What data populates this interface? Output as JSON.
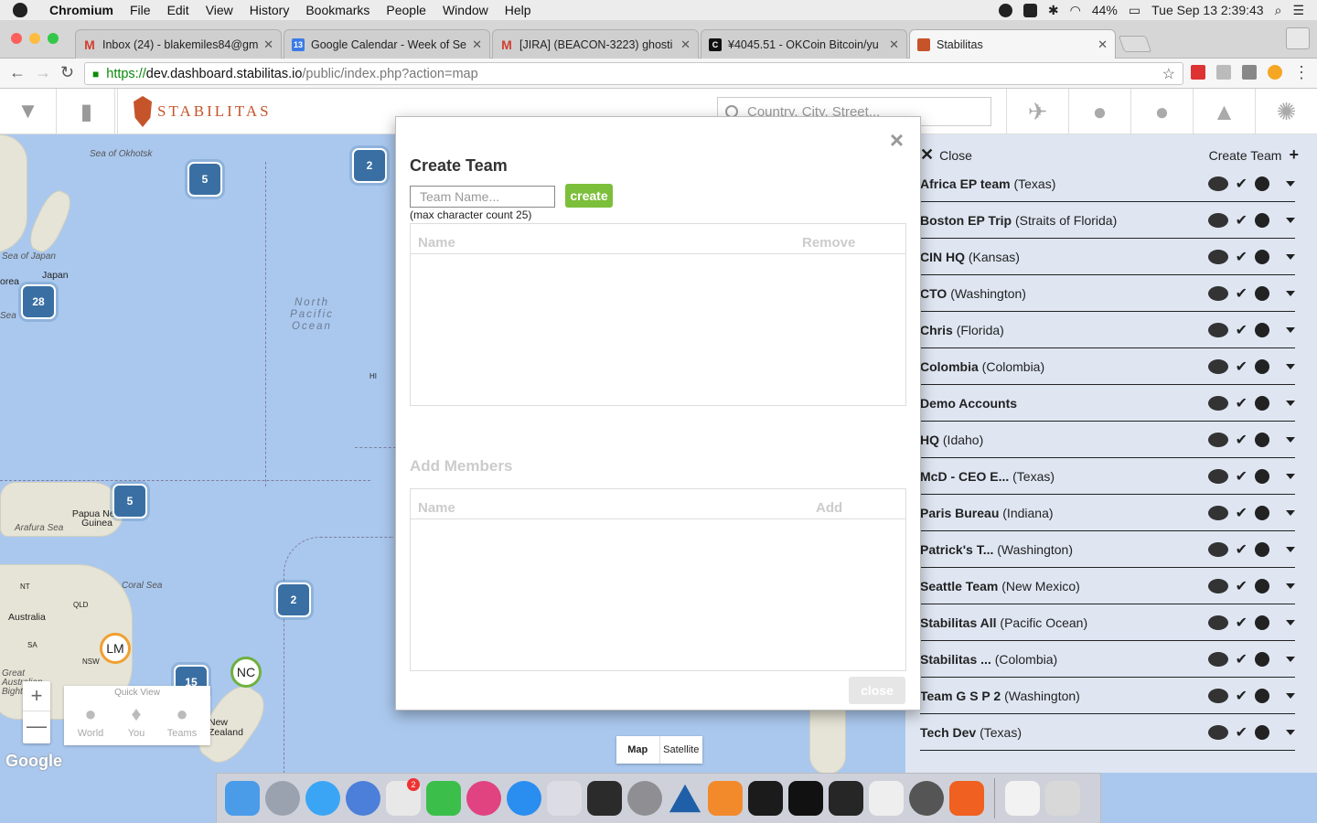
{
  "menubar": {
    "items": [
      "Chromium",
      "File",
      "Edit",
      "View",
      "History",
      "Bookmarks",
      "People",
      "Window",
      "Help"
    ],
    "battery": "44%",
    "clock": "Tue Sep 13  2:39:43"
  },
  "tabs": [
    {
      "title": "Inbox (24) - blakemiles84@gm",
      "favicon": "gmail-icon",
      "color": "#d23f31"
    },
    {
      "title": "Google Calendar - Week of Se",
      "favicon": "calendar-icon",
      "color": "#3b7be8",
      "fav_text": "13"
    },
    {
      "title": "[JIRA] (BEACON-3223) ghosti",
      "favicon": "gmail-icon",
      "color": "#d23f31"
    },
    {
      "title": "¥4045.51 - OKCoin Bitcoin/yu",
      "favicon": "okcoin-icon",
      "color": "#111",
      "fav_text": "C"
    },
    {
      "title": "Stabilitas",
      "favicon": "stabilitas-icon",
      "color": "#c6542a"
    }
  ],
  "address": {
    "scheme": "https://",
    "host": "dev.dashboard.stabilitas.io",
    "path": "/public/index.php?action=map"
  },
  "app": {
    "logo_text": "STABILITAS",
    "search_placeholder": "Country, City, Street..."
  },
  "map": {
    "labels": [
      {
        "text": "Sea of Okhotsk"
      },
      {
        "text": "Sea of Japan"
      },
      {
        "text": "Japan"
      },
      {
        "text": "orea"
      },
      {
        "text": "Sea"
      },
      {
        "text": "HI"
      },
      {
        "text": "Papua New Guinea"
      },
      {
        "text": "Arafura Sea"
      },
      {
        "text": "Coral Sea"
      },
      {
        "text": "NT"
      },
      {
        "text": "QLD"
      },
      {
        "text": "Australia"
      },
      {
        "text": "SA"
      },
      {
        "text": "NSW"
      },
      {
        "text": "Great Australian Bight"
      },
      {
        "text": "New Zealand"
      }
    ],
    "ocean_label": "North Pacific Ocean",
    "clusters": [
      "5",
      "2",
      "28",
      "5",
      "2",
      "15"
    ],
    "pins": [
      "LM",
      "NC"
    ],
    "zoom_in": "+",
    "zoom_out": "—",
    "quick_view": {
      "title": "Quick View",
      "items": [
        "World",
        "You",
        "Teams"
      ]
    },
    "google": "Google",
    "map_type": [
      "Map",
      "Satellite"
    ]
  },
  "panel": {
    "close_label": "Close",
    "create_label": "Create Team",
    "teams": [
      {
        "name": "Africa EP team",
        "loc": "(Texas)"
      },
      {
        "name": "Boston EP Trip",
        "loc": "(Straits of Florida)"
      },
      {
        "name": "CIN HQ",
        "loc": "(Kansas)"
      },
      {
        "name": "CTO",
        "loc": "(Washington)"
      },
      {
        "name": "Chris",
        "loc": "(Florida)"
      },
      {
        "name": "Colombia",
        "loc": "(Colombia)"
      },
      {
        "name": "Demo Accounts",
        "loc": ""
      },
      {
        "name": "HQ",
        "loc": "(Idaho)"
      },
      {
        "name": "McD - CEO E...",
        "loc": "(Texas)"
      },
      {
        "name": "Paris Bureau",
        "loc": "(Indiana)"
      },
      {
        "name": "Patrick's T...",
        "loc": "(Washington)"
      },
      {
        "name": "Seattle Team",
        "loc": "(New Mexico)"
      },
      {
        "name": "Stabilitas All",
        "loc": "(Pacific Ocean)"
      },
      {
        "name": "Stabilitas ...",
        "loc": "(Colombia)"
      },
      {
        "name": "Team G S P 2",
        "loc": "(Washington)"
      },
      {
        "name": "Tech Dev",
        "loc": "(Texas)"
      }
    ]
  },
  "modal": {
    "title": "Create Team",
    "name_placeholder": "Team Name...",
    "create_label": "create",
    "hint": "(max character count 25)",
    "table1": {
      "col1": "Name",
      "col2": "Remove"
    },
    "add_members": "Add Members",
    "table2": {
      "col1": "Name",
      "col2": "Add"
    },
    "close_label": "close"
  }
}
